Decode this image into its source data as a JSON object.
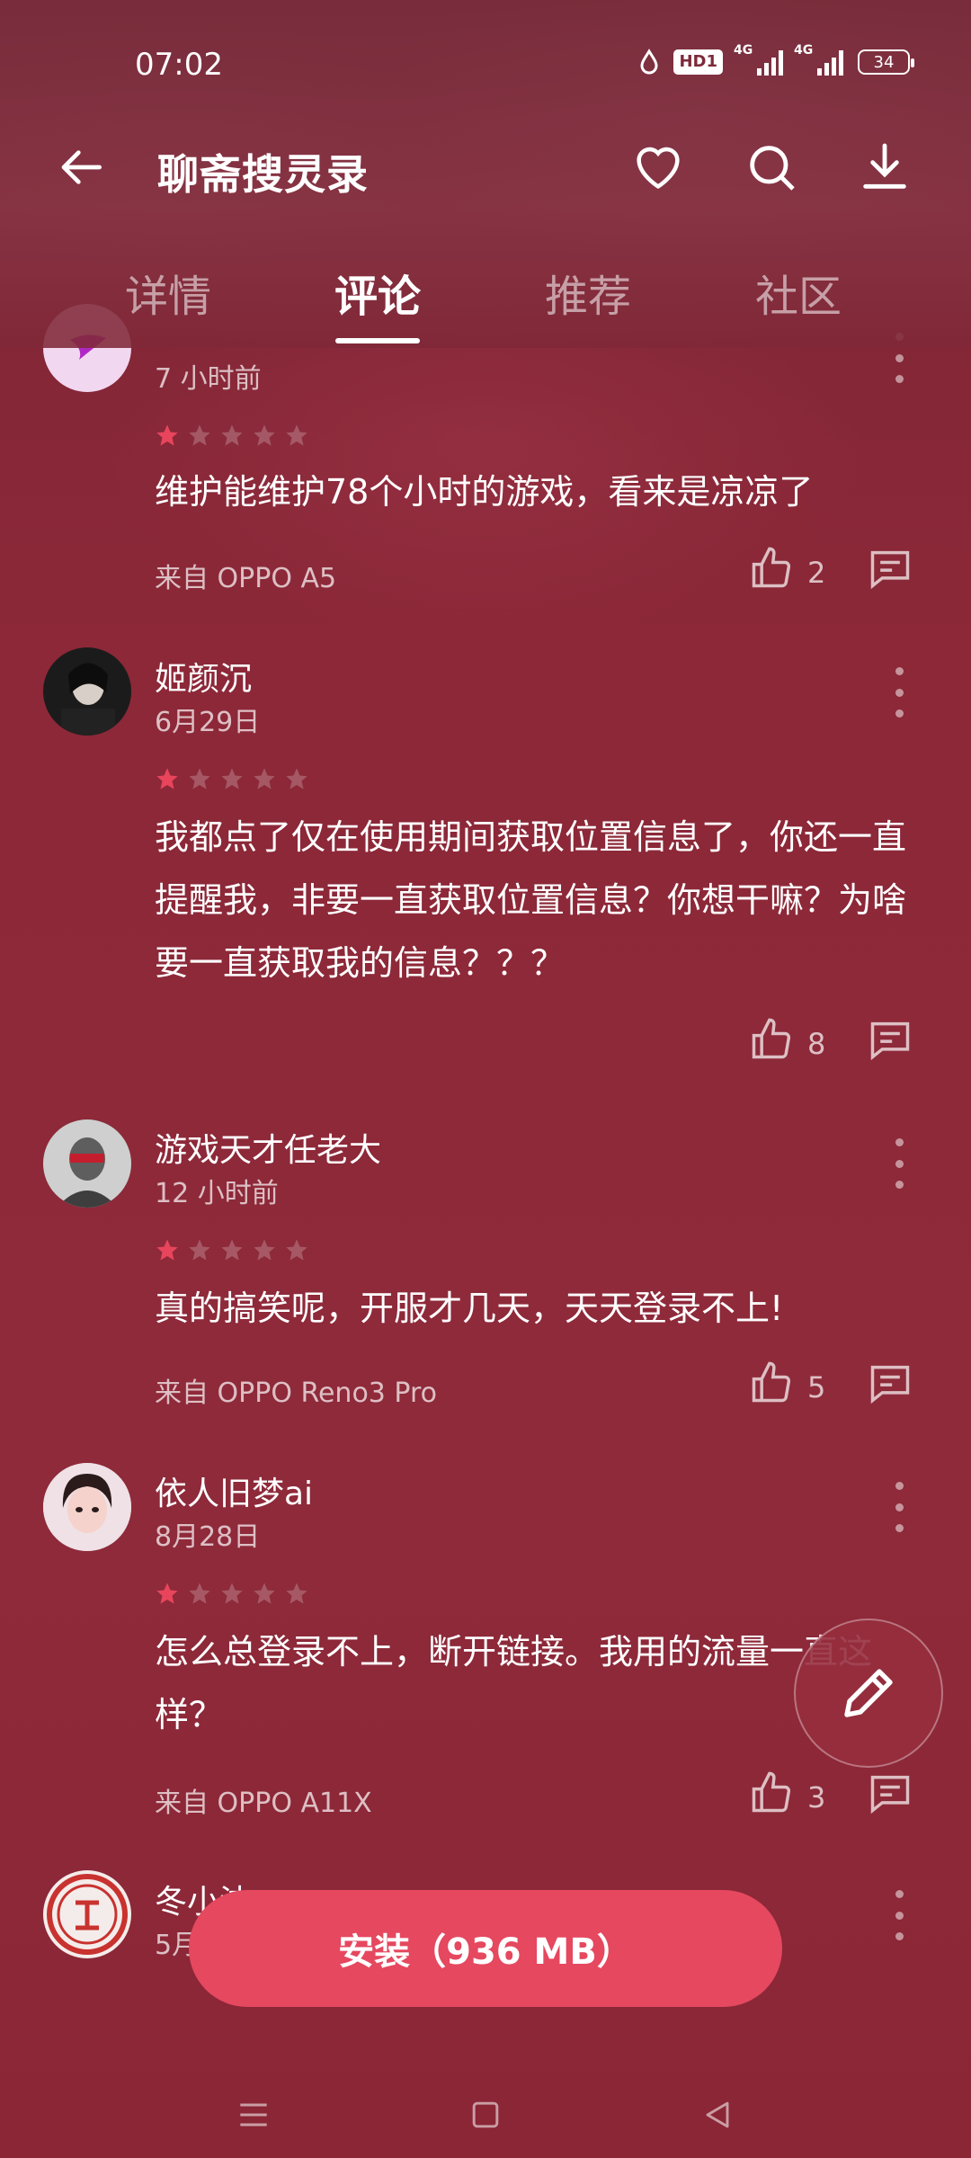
{
  "status_bar": {
    "time": "07:02",
    "hd": "HD1",
    "net1": "4G",
    "net2": "4G",
    "battery": "34"
  },
  "app": {
    "title": "聊斋搜灵录"
  },
  "tabs": [
    {
      "label": "详情",
      "active": false
    },
    {
      "label": "评论",
      "active": true
    },
    {
      "label": "推荐",
      "active": false
    },
    {
      "label": "社区",
      "active": false
    }
  ],
  "reviews": [
    {
      "user": "",
      "date": "7 小时前",
      "rating": 1,
      "text": "维护能维护78个小时的游戏，看来是凉凉了",
      "device": "来自 OPPO A5",
      "likes": "2"
    },
    {
      "user": "姬颜沉",
      "date": "6月29日",
      "rating": 1,
      "text": "我都点了仅在使用期间获取位置信息了，你还一直提醒我，非要一直获取位置信息？你想干嘛？为啥要一直获取我的信息？？？",
      "device": "",
      "likes": "8"
    },
    {
      "user": "游戏天才任老大",
      "date": "12 小时前",
      "rating": 1,
      "text": "真的搞笑呢，开服才几天，天天登录不上!",
      "device": "来自 OPPO Reno3 Pro",
      "likes": "5"
    },
    {
      "user": "依人旧梦ai",
      "date": "8月28日",
      "rating": 1,
      "text": "怎么总登录不上，断开链接。我用的流量一直这样？",
      "device": "来自 OPPO A11X",
      "likes": "3"
    },
    {
      "user": "冬小沫",
      "date": "5月",
      "rating": 1,
      "text": "",
      "device": "",
      "likes": ""
    }
  ],
  "install_button": "安装（936 MB）",
  "colors": {
    "accent": "#e5485f",
    "star_on": "#e8455c",
    "background": "#8c2838"
  }
}
